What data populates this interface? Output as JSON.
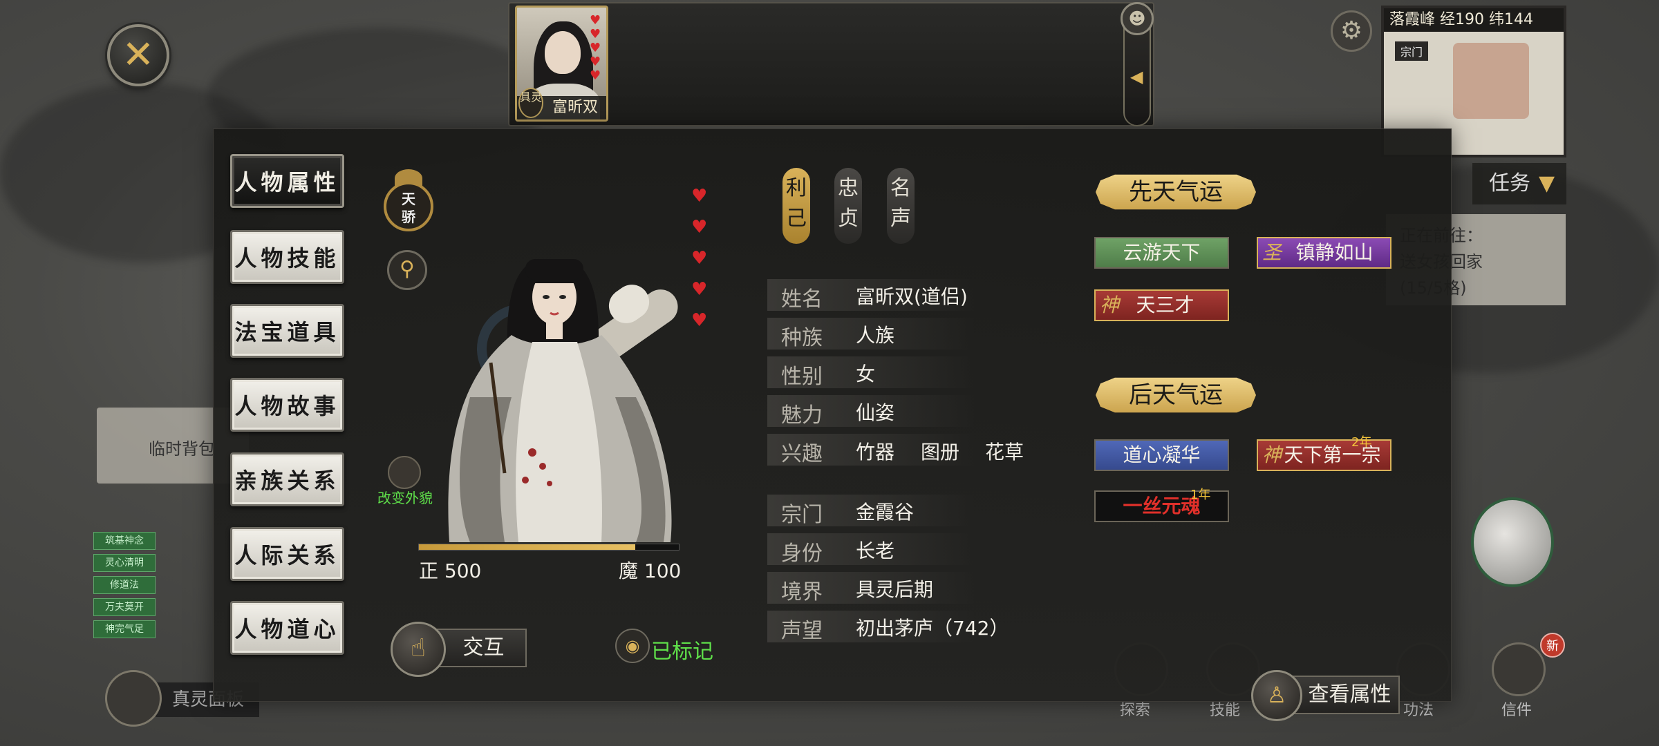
{
  "close_button_glyph": "✕",
  "top_strip": {
    "portrait_name": "富昕双",
    "portrait_tag": "具灵",
    "hearts": [
      "♥",
      "♥",
      "♥",
      "♥",
      "♥"
    ],
    "side_button_glyph": "◀"
  },
  "minimap": {
    "header": "落霞峰 经190 纬144",
    "label": "宗门"
  },
  "task_panel": {
    "title": "任务",
    "arrow": "▼",
    "body_lines": [
      "正在前往：",
      "送女孩回家",
      "(15/5格)"
    ]
  },
  "background": {
    "temp_item_label": "临时背包",
    "green_tags": [
      "筑基神念",
      "灵心清明",
      "修道法",
      "万夫莫开",
      "神完气足"
    ],
    "bottom_left_label": "真灵面板",
    "bottom_icons": [
      "探索",
      "技能",
      "功法",
      "信件"
    ],
    "new_badge": "新"
  },
  "tabs": [
    {
      "label": "人物属性",
      "active": true
    },
    {
      "label": "人物技能",
      "active": false
    },
    {
      "label": "法宝道具",
      "active": false
    },
    {
      "label": "人物故事",
      "active": false
    },
    {
      "label": "亲族关系",
      "active": false
    },
    {
      "label": "人际关系",
      "active": false
    },
    {
      "label": "人物道心",
      "active": false
    }
  ],
  "portrait": {
    "badge_text_top": "天",
    "badge_text_bottom": "骄",
    "search_glyph": "⚲",
    "change_look_label": "改变外貌",
    "hearts": [
      "♥",
      "♥",
      "♥",
      "♥",
      "♥"
    ],
    "alignment": {
      "righteous_label": "正 500",
      "demonic_label": "魔 100",
      "righteous_value": 500,
      "demonic_value": 100
    },
    "interact_label": "交互",
    "interact_glyph": "☝",
    "marked_label": "已标记",
    "marked_glyph": "◉"
  },
  "traits": [
    {
      "label": "利\n己",
      "active": true
    },
    {
      "label": "忠\n贞",
      "active": false
    },
    {
      "label": "名\n声",
      "active": false
    }
  ],
  "info": {
    "name_key": "姓名",
    "name_val": "富昕双(道侣)",
    "race_key": "种族",
    "race_val": "人族",
    "gender_key": "性别",
    "gender_val": "女",
    "charm_key": "魅力",
    "charm_val": "仙姿",
    "hobby_key": "兴趣",
    "hobbies": [
      "竹器",
      "图册",
      "花草"
    ],
    "sect_key": "宗门",
    "sect_val": "金霞谷",
    "identity_key": "身份",
    "identity_val": "长老",
    "realm_key": "境界",
    "realm_val": "具灵后期",
    "fame_key": "声望",
    "fame_val": "初出茅庐（742）"
  },
  "fate": {
    "innate_title": "先天气运",
    "innate": [
      {
        "label": "云游天下",
        "style": "green"
      },
      {
        "label": "镇静如山",
        "style": "purple",
        "glyph": "圣"
      },
      {
        "label": "天三才",
        "style": "red",
        "glyph": "神"
      }
    ],
    "acquired_title": "后天气运",
    "acquired": [
      {
        "label": "道心凝华",
        "style": "blue"
      },
      {
        "label": "天下第一宗",
        "style": "red",
        "glyph": "神",
        "duration": "2年"
      },
      {
        "label": "一丝元魂",
        "style": "black",
        "duration": "1年"
      }
    ]
  },
  "view_attr_label": "查看属性",
  "view_attr_glyph": "♙",
  "colors": {
    "accent_gold": "#d9b25a",
    "heart_red": "#d8262a",
    "marked_green": "#5fe04a"
  }
}
